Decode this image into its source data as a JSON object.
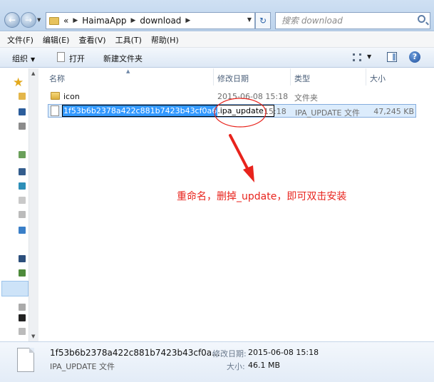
{
  "address_bar": {
    "back_label": "←",
    "forward_label": "→",
    "crumb_prefix": "«",
    "breadcrumbs": [
      "HaimaApp",
      "download"
    ],
    "refresh_label": "↻",
    "search_placeholder": "搜索 download"
  },
  "menu": {
    "items": [
      "文件(F)",
      "编辑(E)",
      "查看(V)",
      "工具(T)",
      "帮助(H)"
    ]
  },
  "toolbar": {
    "organize": "组织",
    "open": "打开",
    "new_folder": "新建文件夹",
    "help": "?"
  },
  "columns": {
    "name": "名称",
    "date": "修改日期",
    "type": "类型",
    "size": "大小"
  },
  "files": [
    {
      "name": "icon",
      "date": "2015-06-08 15:18",
      "type": "文件夹",
      "size": "",
      "icon": "folder-icon"
    },
    {
      "name_selected": "1f53b6b2378a422c881b7423b43cf0a6",
      "name_suffix": ".ipa_update",
      "date": "15:18",
      "type": "IPA_UPDATE 文件",
      "size": "47,245 KB",
      "icon": "file-icon"
    }
  ],
  "annotation": {
    "text": "重命名，删掉_update，即可双击安装",
    "color": "#e8231c"
  },
  "details": {
    "name": "1f53b6b2378a422c881b7423b43cf0a...",
    "modified_label": "修改日期:",
    "modified": "2015-06-08 15:18",
    "type": "IPA_UPDATE 文件",
    "size_label": "大小:",
    "size": "46.1 MB"
  },
  "colors": {
    "selection": "#3399ff",
    "row_selected": "#dcecfc",
    "chrome": "#cfe0f3"
  }
}
